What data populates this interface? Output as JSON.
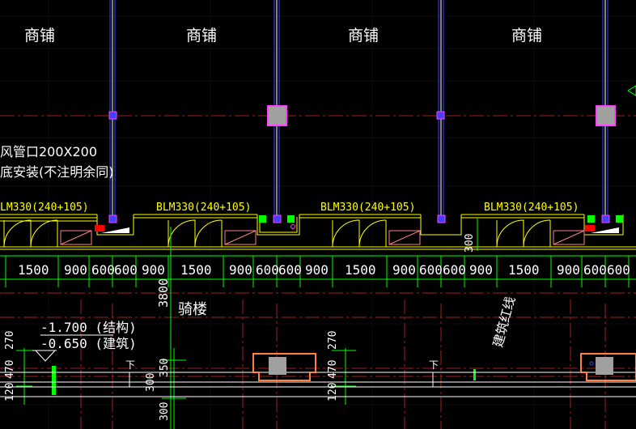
{
  "room_labels": [
    "商铺",
    "商铺",
    "商铺",
    "商铺"
  ],
  "note_line1": "风管口200X200",
  "note_line2": "底安装(不注明余同)",
  "door_labels": [
    "LM330(240+105)",
    "BLM330(240+105)",
    "BLM330(240+105)",
    "BLM330(240+105)"
  ],
  "dim_300_top": "300",
  "dims_row": [
    "1500",
    "900",
    "600",
    "600",
    "900",
    "1500",
    "900",
    "600",
    "600",
    "900",
    "1500",
    "900",
    "600",
    "600",
    "900",
    "1500",
    "900",
    "600",
    "600"
  ],
  "arcade_label": "骑楼",
  "dim_3800": "3800",
  "level_struct": "-1.700 (结构)",
  "level_arch": "-0.650 (建筑)",
  "red_line_label": "建筑红线",
  "left_dims": [
    "270",
    "470",
    "120"
  ],
  "mid_dims": [
    "300",
    "350",
    "300"
  ],
  "right_dims": [
    "270",
    "470",
    "120"
  ],
  "down_arrow": "下",
  "colors": {
    "grid": "#9c2020",
    "axis": "#4040ff",
    "column": "#a0a0a0",
    "wall": "#ffff00",
    "dimension": "#00ff00",
    "hatch": "#ff8080"
  }
}
